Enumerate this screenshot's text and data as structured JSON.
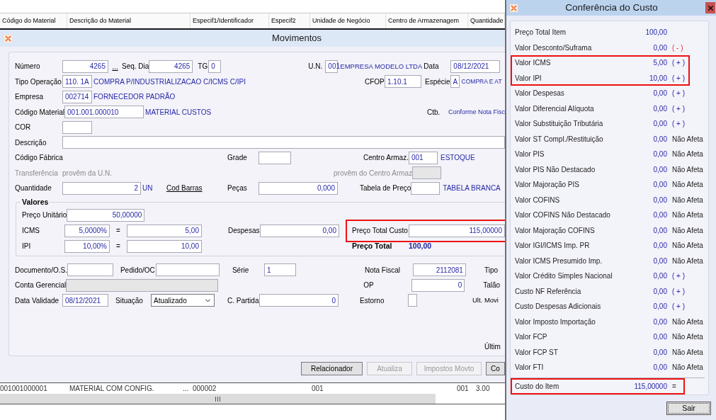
{
  "grid_header": {
    "columns": [
      "Código do Material",
      "Descrição do Material",
      "Especif1/Identificador",
      "Especif2",
      "Unidade de Negócio",
      "Centro de Armazenagem",
      "Quantidade"
    ]
  },
  "movimentos": {
    "title": "Movimentos",
    "numero": {
      "label": "Número",
      "value": "4265",
      "lookup": "..."
    },
    "seq_dia": {
      "label": "Seq. Dia",
      "value": "4265"
    },
    "tg": {
      "label": "TG",
      "value": "0"
    },
    "un": {
      "label": "U.N.",
      "value": "001",
      "description": "EMPRESA MODELO LTDA"
    },
    "data": {
      "label": "Data",
      "value": "08/12/2021"
    },
    "tipo_operacao": {
      "label": "Tipo Operação",
      "value": "110. 1A",
      "description": "COMPRA P/INDUSTRIALIZACAO C/ICMS C/IPI"
    },
    "cfop": {
      "label": "CFOP",
      "value": "1.10.1"
    },
    "especie": {
      "label": "Espécie",
      "value": "A",
      "description": "COMPRA E AT"
    },
    "empresa": {
      "label": "Empresa",
      "value": "002714",
      "description": "FORNECEDOR PADRÃO"
    },
    "codigo_material": {
      "label": "Código Material",
      "value": "001.001.000010",
      "description": "MATERIAL CUSTOS"
    },
    "ctb": {
      "label": "Ctb.",
      "value": "Conforme Nota Fisc"
    },
    "cor": {
      "label": "COR"
    },
    "descricao": {
      "label": "Descrição"
    },
    "codigo_fabrica": {
      "label": "Código Fábrica"
    },
    "grade": {
      "label": "Grade"
    },
    "centro_armaz": {
      "label": "Centro Armaz.",
      "value": "001",
      "description": "ESTOQUE"
    },
    "transferencia": {
      "label": "Transferência",
      "text": "provêm da U.N.",
      "disabled": true
    },
    "provem_centro": {
      "label": "provêm do Centro Armaz",
      "disabled": true
    },
    "quantidade": {
      "label": "Quantidade",
      "value": "2",
      "unit": "UN"
    },
    "cod_barras": "Cod Barras",
    "pecas": {
      "label": "Peças",
      "value": "0,000"
    },
    "tabela_preco": {
      "label": "Tabela de Preço",
      "description": "TABELA BRANCA"
    },
    "valores": {
      "title": "Valores",
      "preco_unitario": {
        "label": "Preço Unitário",
        "value": "50,00000"
      },
      "icms": {
        "label": "ICMS",
        "rate": "5,0000%",
        "equals": "=",
        "value": "5,00"
      },
      "ipi": {
        "label": "IPI",
        "rate": "10,00%",
        "equals": "=",
        "value": "10,00"
      }
    },
    "despesas": {
      "label": "Despesas",
      "value": "0,00"
    },
    "preco_total_custo": {
      "label": "Preço Total Custo",
      "value": "115,00000",
      "highlighted": true
    },
    "preco_total": {
      "label": "Preço Total",
      "value": "100,00"
    },
    "documento": {
      "label": "Documento/O.S."
    },
    "pedido_oc": {
      "label": "Pedido/OC"
    },
    "serie": {
      "label": "Série",
      "value": "1"
    },
    "nota_fiscal": {
      "label": "Nota Fiscal",
      "value": "2112081"
    },
    "tipo": {
      "label": "Tipo"
    },
    "conta_gerencial": {
      "label": "Conta Gerencial",
      "disabled": true
    },
    "op": {
      "label": "OP",
      "value": "0"
    },
    "talao": {
      "label": "Talão"
    },
    "data_validade": {
      "label": "Data Validade",
      "value": "08/12/2021"
    },
    "situacao": {
      "label": "Situação",
      "value": "Atualizado"
    },
    "c_partida": {
      "label": "C. Partida",
      "value": "0"
    },
    "estorno": {
      "label": "Estorno",
      "checked": false
    },
    "ult_movi": "Ult. Movi",
    "ultim": "Últim",
    "buttons": [
      {
        "label": "Relacionador",
        "disabled": false
      },
      {
        "label": "Atualiza",
        "disabled": true
      },
      {
        "label": "Impostos Movto",
        "disabled": true
      },
      {
        "label": "Co",
        "disabled": false
      }
    ]
  },
  "grid_row": [
    "001001000001",
    "MATERIAL COM CONFIG.",
    "...",
    "000002",
    "001",
    "001",
    "3.00"
  ],
  "conferencia": {
    "title": "Conferência do Custo",
    "rows": [
      {
        "label": "Preço Total Item",
        "value": "100,00",
        "highlighted": false
      },
      {
        "label": "Valor Desconto/Suframa",
        "value": "0,00",
        "effect": {
          "kind": "minus",
          "text": "( - )"
        },
        "highlighted": false
      },
      {
        "label": "Valor ICMS",
        "value": "5,00",
        "effect": {
          "kind": "plus",
          "text": "( + )"
        },
        "highlighted": true
      },
      {
        "label": "Valor IPI",
        "value": "10,00",
        "effect": {
          "kind": "plus",
          "text": "( + )"
        },
        "highlighted": true
      },
      {
        "label": "Valor Despesas",
        "value": "0,00",
        "effect": {
          "kind": "plus",
          "text": "( + )"
        },
        "highlighted": false
      },
      {
        "label": "Valor Diferencial Alíquota",
        "value": "0,00",
        "effect": {
          "kind": "plus",
          "text": "( + )"
        },
        "highlighted": false
      },
      {
        "label": "Valor Substituição Tributária",
        "value": "0,00",
        "effect": {
          "kind": "plus",
          "text": "( + )"
        },
        "highlighted": false
      },
      {
        "label": "Valor ST Compl./Restituição",
        "value": "0,00",
        "effect": {
          "kind": "none",
          "text": "Não Afeta"
        },
        "highlighted": false
      },
      {
        "label": "Valor PIS",
        "value": "0,00",
        "effect": {
          "kind": "none",
          "text": "Não Afeta"
        },
        "highlighted": false
      },
      {
        "label": "Valor PIS Não Destacado",
        "value": "0,00",
        "effect": {
          "kind": "none",
          "text": "Não Afeta"
        },
        "highlighted": false
      },
      {
        "label": "Valor Majoração PIS",
        "value": "0,00",
        "effect": {
          "kind": "none",
          "text": "Não Afeta"
        },
        "highlighted": false
      },
      {
        "label": "Valor COFINS",
        "value": "0,00",
        "effect": {
          "kind": "none",
          "text": "Não Afeta"
        },
        "highlighted": false
      },
      {
        "label": "Valor COFINS Não Destacado",
        "value": "0,00",
        "effect": {
          "kind": "none",
          "text": "Não Afeta"
        },
        "highlighted": false
      },
      {
        "label": "Valor Majoração COFINS",
        "value": "0,00",
        "effect": {
          "kind": "none",
          "text": "Não Afeta"
        },
        "highlighted": false
      },
      {
        "label": "Valor IGI/ICMS Imp. PR",
        "value": "0,00",
        "effect": {
          "kind": "none",
          "text": "Não Afeta"
        },
        "highlighted": false
      },
      {
        "label": "Valor ICMS Presumido Imp.",
        "value": "0,00",
        "effect": {
          "kind": "none",
          "text": "Não Afeta"
        },
        "highlighted": false
      },
      {
        "label": "Valor Crédito Simples Nacional",
        "value": "0,00",
        "effect": {
          "kind": "plus",
          "text": "( + )"
        },
        "highlighted": false
      },
      {
        "label": "Custo NF Referência",
        "value": "0,00",
        "effect": {
          "kind": "plus",
          "text": "( + )"
        },
        "highlighted": false
      },
      {
        "label": "Custo Despesas Adicionais",
        "value": "0,00",
        "effect": {
          "kind": "plus",
          "text": "( + )"
        },
        "highlighted": false
      },
      {
        "label": "Valor Imposto Importação",
        "value": "0,00",
        "effect": {
          "kind": "none",
          "text": "Não Afeta"
        },
        "highlighted": false
      },
      {
        "label": "Valor FCP",
        "value": "0,00",
        "effect": {
          "kind": "none",
          "text": "Não Afeta"
        },
        "highlighted": false
      },
      {
        "label": "Valor FCP ST",
        "value": "0,00",
        "effect": {
          "kind": "none",
          "text": "Não Afeta"
        },
        "highlighted": false
      },
      {
        "label": "Valor FTI",
        "value": "0,00",
        "effect": {
          "kind": "none",
          "text": "Não Afeta"
        },
        "highlighted": false
      }
    ],
    "total": {
      "label": "Custo do Item",
      "value": "115,00000",
      "effect": {
        "kind": "equals",
        "text": "="
      },
      "highlighted": true
    },
    "button": "Sair"
  }
}
